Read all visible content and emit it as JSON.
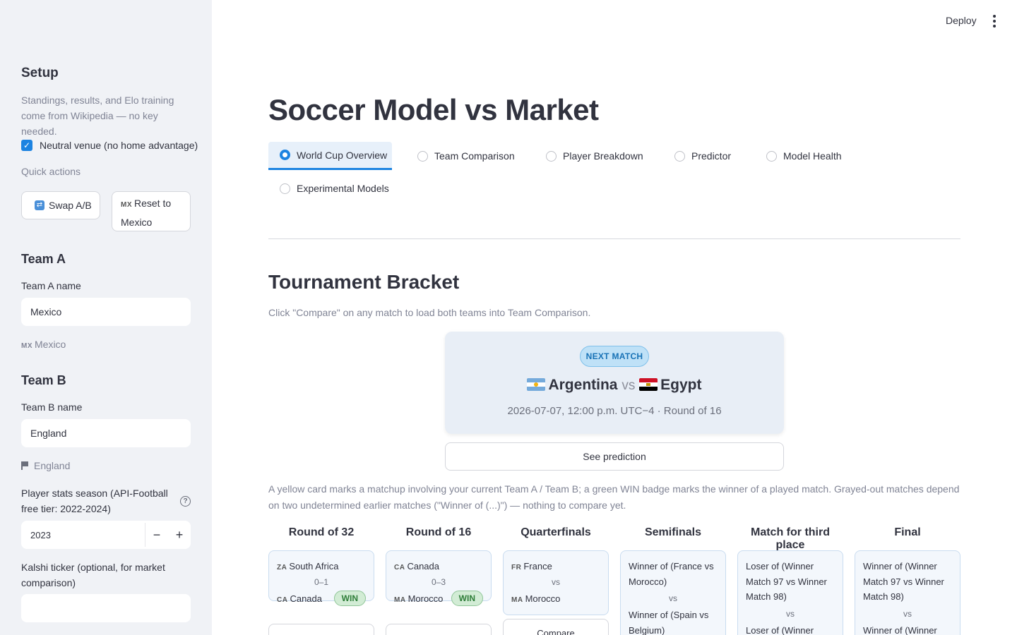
{
  "topbar": {
    "deploy_label": "Deploy"
  },
  "sidebar": {
    "setup_title": "Setup",
    "setup_desc": "Standings, results, and Elo training come from Wikipedia — no key needed.",
    "neutral_label": "Neutral venue (no home advantage)",
    "neutral_checked": true,
    "quick_actions_label": "Quick actions",
    "swap_label": "Swap A/B",
    "reset_cc": "MX",
    "reset_label_1": "Reset to",
    "reset_label_2": "Mexico",
    "team_a_title": "Team A",
    "team_a_name_label": "Team A name",
    "team_a_value": "Mexico",
    "team_a_cc": "MX",
    "team_a_resolved": "Mexico",
    "team_b_title": "Team B",
    "team_b_name_label": "Team B name",
    "team_b_value": "England",
    "team_b_resolved": "England",
    "season_label": "Player stats season (API-Football free tier: 2022-2024)",
    "season_value": "2023",
    "kalshi_label": "Kalshi ticker (optional, for market comparison)",
    "kalshi_value": ""
  },
  "main": {
    "title": "Soccer Model vs Market",
    "tabs": [
      {
        "label": "World Cup Overview",
        "active": true
      },
      {
        "label": "Team Comparison",
        "active": false
      },
      {
        "label": "Player Breakdown",
        "active": false
      },
      {
        "label": "Predictor",
        "active": false
      },
      {
        "label": "Model Health",
        "active": false
      },
      {
        "label": "Experimental Models",
        "active": false
      }
    ],
    "bracket_title": "Tournament Bracket",
    "bracket_caption": "Click \"Compare\" on any match to load both teams into Team Comparison.",
    "next_match": {
      "badge": "NEXT MATCH",
      "team1": "Argentina",
      "vs": "vs",
      "team2": "Egypt",
      "meta": "2026-07-07, 12:00 p.m. UTC−4 · Round of 16",
      "see_prediction": "See prediction"
    },
    "legend_caption": "A yellow card marks a matchup involving your current Team A / Team B; a green WIN badge marks the winner of a played match. Grayed-out matches depend on two undetermined earlier matches (\"Winner of (...)\") — nothing to compare yet.",
    "rounds": [
      {
        "name": "Round of 32",
        "t1_cc": "ZA",
        "t1": "South Africa",
        "score": "0–1",
        "t2_cc": "CA",
        "t2": "Canada",
        "win": "WIN"
      },
      {
        "name": "Round of 16",
        "t1_cc": "CA",
        "t1": "Canada",
        "score": "0–3",
        "t2_cc": "MA",
        "t2": "Morocco",
        "win": "WIN"
      },
      {
        "name": "Quarterfinals",
        "t1_cc": "FR",
        "t1": "France",
        "vs": "vs",
        "t2_cc": "MA",
        "t2": "Morocco",
        "compare": "Compare"
      },
      {
        "name": "Semifinals",
        "p1": "Winner of (France vs Morocco)",
        "vs": "vs",
        "p2": "Winner of (Spain vs Belgium)"
      },
      {
        "name": "Match for third place",
        "p1": "Loser of (Winner Match 97 vs Winner Match 98)",
        "vs": "vs",
        "p2": "Loser of (Winner"
      },
      {
        "name": "Final",
        "p1": "Winner of (Winner Match 97 vs Winner Match 98)",
        "vs": "vs",
        "p2": "Winner of (Winner"
      }
    ],
    "compare_label": "Compare"
  }
}
